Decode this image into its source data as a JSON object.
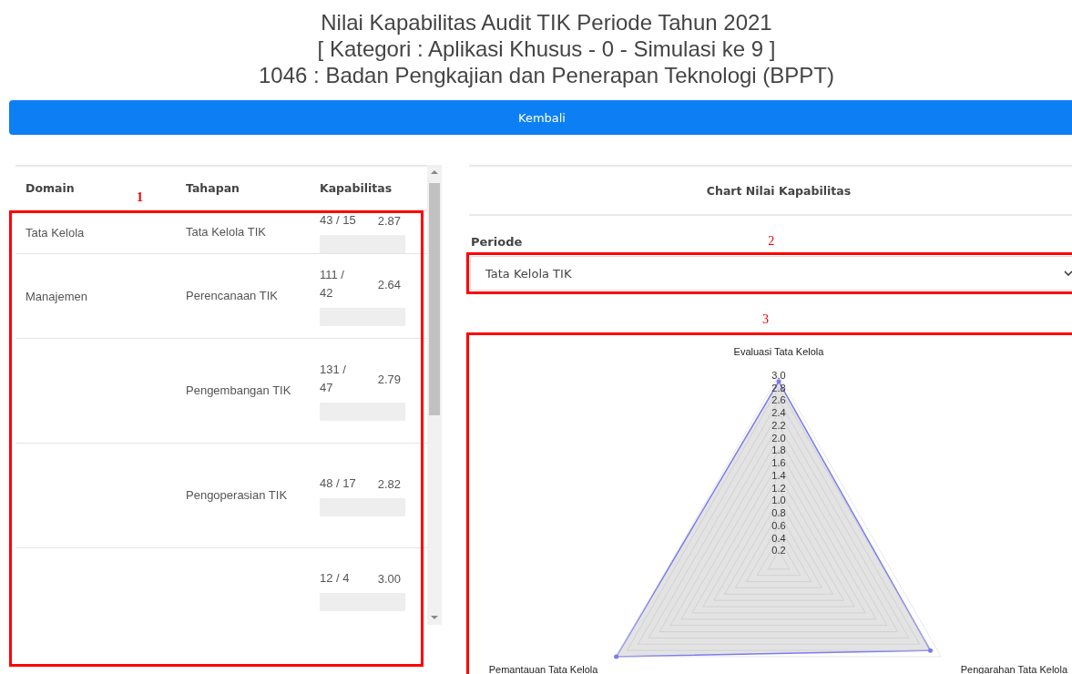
{
  "header": {
    "title_lines": [
      "Nilai Kapabilitas Audit TIK Periode Tahun 2021",
      "[ Kategori : Aplikasi Khusus - 0 - Simulasi ke 9 ]",
      "1046 : Badan Pengkajian dan Penerapan Teknologi (BPPT)"
    ]
  },
  "back_button": "Kembali",
  "table": {
    "columns": [
      "Domain",
      "Tahapan",
      "Kapabilitas"
    ],
    "rows": [
      {
        "domain": "Tata Kelola",
        "tahapan": "Tata Kelola TIK",
        "ratio": "43 / 15",
        "score": "2.87",
        "level": 0
      },
      {
        "domain": "Manajemen",
        "tahapan": "Perencanaan TIK",
        "ratio": "111 / 42",
        "score": "2.64",
        "level": 0
      },
      {
        "tahapan": "Pengembangan TIK",
        "ratio": "131 / 47",
        "score": "2.79",
        "level": 0
      },
      {
        "tahapan": "Pengoperasian TIK",
        "ratio": "48 / 17",
        "score": "2.82",
        "level": 0
      },
      {
        "ratio": "12 / 4",
        "score": "3.00",
        "level": 0
      }
    ]
  },
  "chart_panel": {
    "title": "Chart Nilai Kapabilitas",
    "periode_label": "Periode",
    "periode_value": "Tata Kelola TIK",
    "chart_data": {
      "type": "radar",
      "categories": [
        "Evaluasi Tata Kelola",
        "Pengarahan Tata Kelola",
        "Pemantauan Tata Kelola"
      ],
      "series": [
        {
          "color": "#7b7bf0",
          "values": [
            2.9,
            2.8,
            3.0
          ]
        }
      ],
      "ylim": [
        0,
        3
      ],
      "yticks": [
        {
          "value": 0.2,
          "label": "0.2"
        },
        {
          "value": 0.4,
          "label": "0.4"
        },
        {
          "value": 0.6,
          "label": "0.6"
        },
        {
          "value": 0.8,
          "label": "0.8"
        },
        {
          "value": 1.0,
          "label": "1.0"
        },
        {
          "value": 1.2,
          "label": "1.2"
        },
        {
          "value": 1.4,
          "label": "1.4"
        },
        {
          "value": 1.6,
          "label": "1.6"
        },
        {
          "value": 1.8,
          "label": "1.8"
        },
        {
          "value": 2.0,
          "label": "2.0"
        },
        {
          "value": 2.2,
          "label": "2.2"
        },
        {
          "value": 2.4,
          "label": "2.4"
        },
        {
          "value": 2.6,
          "label": "2.6"
        },
        {
          "value": 2.8,
          "label": "2.8"
        },
        {
          "value": 3.0,
          "label": "3.0"
        }
      ]
    }
  },
  "annotations": [
    "1",
    "2",
    "3"
  ]
}
